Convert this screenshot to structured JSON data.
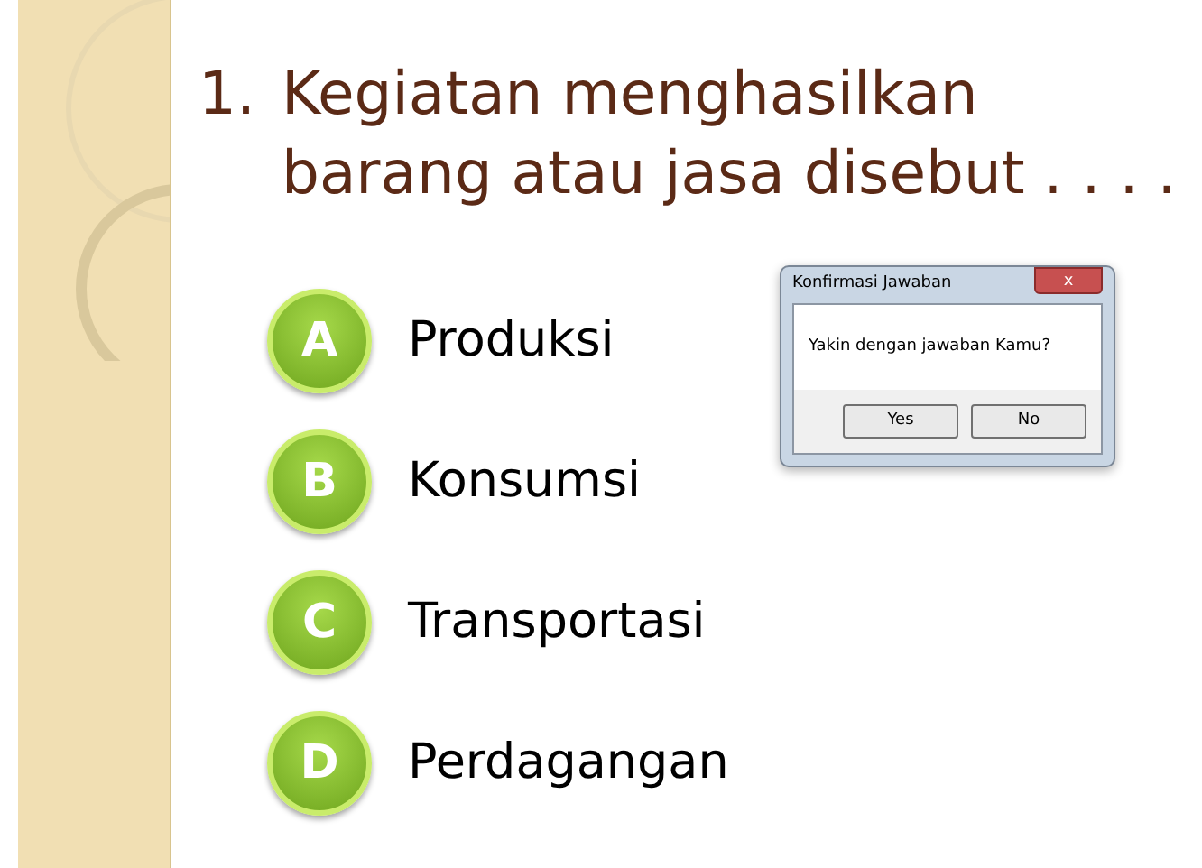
{
  "question": {
    "number": "1.",
    "text": "Kegiatan menghasilkan barang atau jasa disebut . . . ."
  },
  "options": [
    {
      "letter": "A",
      "label": "Produksi"
    },
    {
      "letter": "B",
      "label": "Konsumsi"
    },
    {
      "letter": "C",
      "label": "Transportasi"
    },
    {
      "letter": "D",
      "label": "Perdagangan"
    }
  ],
  "dialog": {
    "title": "Konfirmasi Jawaban",
    "close": "x",
    "message": "Yakin dengan jawaban Kamu?",
    "buttons": [
      "Yes",
      "No"
    ]
  }
}
